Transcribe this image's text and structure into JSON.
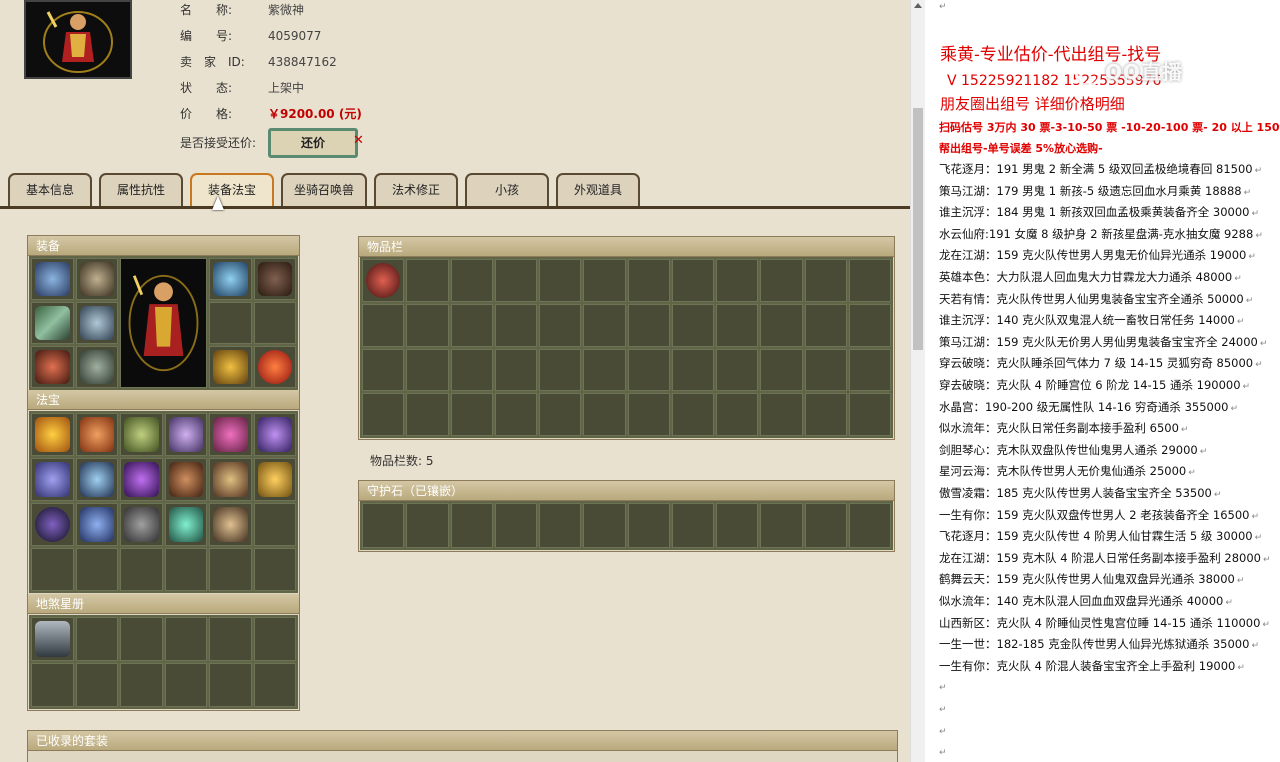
{
  "item": {
    "rows": [
      {
        "label": "名　　称:",
        "value": "紫微神"
      },
      {
        "label": "编　　号:",
        "value": "4059077"
      },
      {
        "label": "卖　家　ID:",
        "value": "438847162"
      },
      {
        "label": "状　　态:",
        "value": "上架中"
      },
      {
        "label": "价　　格:",
        "value": "￥9200.00 (元)"
      }
    ],
    "counter_label": "是否接受还价:",
    "counter_button": "还价"
  },
  "tabs": [
    "基本信息",
    "属性抗性",
    "装备法宝",
    "坐骑召唤兽",
    "法术修正",
    "小孩",
    "外观道具"
  ],
  "active_tab": "装备法宝",
  "panels": {
    "equipment": "装备",
    "fabao": "法宝",
    "dishaxingce": "地煞星册",
    "inventory": "物品栏",
    "inventory_count": "物品栏数: 5",
    "guardian": "守护石（已镶嵌）",
    "suits": "已收录的套装"
  },
  "doc": {
    "title": "乘黄-专业估价-代出组号-找号",
    "phone": "V 15225921182   15225355976",
    "friend": "朋友圈出组号    详细价格明细",
    "red1": "扫码估号 3万内 30 票-3-10-50 票  -10-20-100 票- 20 以上 150",
    "red2": "帮出组号-单号误差 5%放心选购-",
    "watermark": "QQ直播",
    "lines": [
      "飞花逐月：191 男鬼 2 新全满 5 级双回孟极绝境春回 81500",
      "策马江湖：179 男鬼 1 新孩-5 级遗忘回血水月乘黄 18888",
      "谁主沉浮：184 男鬼 1 新孩双回血孟极乘黄装备齐全 30000",
      "水云仙府:191 女魔 8 级护身 2 新孩星盘满-克水抽女魔 9288",
      "龙在江湖：159 克火队传世男人男鬼无价仙异光通杀 19000",
      "英雄本色：大力队混人回血鬼大力甘霖龙大力通杀 48000",
      "天若有情：克火队传世男人仙男鬼装备宝宝齐全通杀 50000",
      "谁主沉浮：140 克火队双鬼混人统一畜牧日常任务 14000",
      "策马江湖：159 克火队无价男人男仙男鬼装备宝宝齐全 24000",
      "穿云破晓：克火队睡杀回气体力 7 级 14-15 灵狐穷奇 85000",
      "穿去破晓：克火队 4 阶睡宫位 6 阶龙 14-15 通杀 190000",
      "水晶宫：190-200 级无属性队 14-16 穷奇通杀 355000",
      "似水流年：克火队日常任务副本接手盈利 6500",
      "剑胆琴心：克木队双盘队传世仙鬼男人通杀 29000",
      "星河云海：克木队传世男人无价鬼仙通杀 25000",
      "傲雪凌霜：185 克火队传世男人装备宝宝齐全 53500",
      "一生有你：159 克火队双盘传世男人 2 老孩装备齐全 16500",
      "飞花逐月：159 克火队传世 4 阶男人仙甘霖生活 5 级 30000",
      "龙在江湖：159 克木队 4 阶混人日常任务副本接手盈利 28000",
      "鹤舞云天：159 克火队传世男人仙鬼双盘异光通杀 38000",
      "似水流年：140 克木队混人回血血双盘异光通杀 40000",
      "山西新区：克火队 4 阶睡仙灵性鬼宫位睡 14-15 通杀 110000",
      "一生一世：182-185 克金队传世男人仙异光炼狱通杀 35000",
      "一生有你：克火队 4 阶混人装备宝宝齐全上手盈利 19000"
    ]
  },
  "colors": {
    "price": "#c00000",
    "doc_red": "#e00000",
    "page_bg": "#e9e1cf",
    "slot": "#494b36"
  }
}
